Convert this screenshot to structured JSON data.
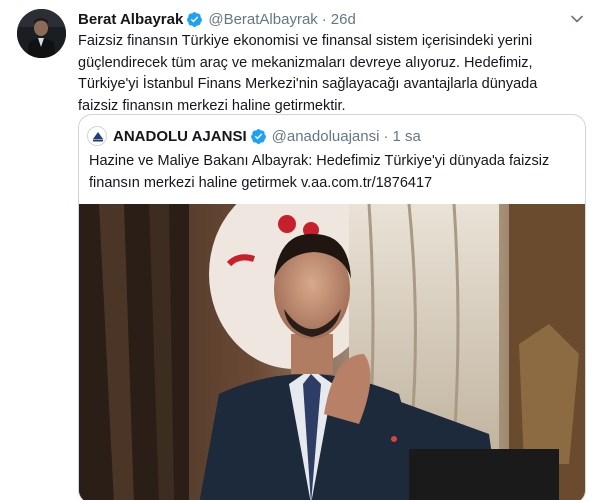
{
  "tweet": {
    "author_name": "Berat Albayrak",
    "handle": "@BeratAlbayrak",
    "separator": "·",
    "time": "26d",
    "text_lines": [
      "Faizsiz finansın Türkiye ekonomisi ve finansal sistem içerisindeki yerini",
      "güçlendirecek tüm araç ve mekanizmaları devreye alıyoruz. Hedefimiz,",
      "Türkiye'yi İstanbul Finans Merkezi'nin sağlayacağı avantajlarla dünyada",
      "faizsiz finansın merkezi haline getirmektir."
    ]
  },
  "quoted_tweet": {
    "author_name": "ANADOLU AJANSI",
    "handle": "@anadoluajansi",
    "separator": "·",
    "time": "1 sa",
    "text_lines": [
      "Hazine ve Maliye Bakanı Albayrak: Hedefimiz Türkiye'yi dünyada faizsiz",
      "finansın merkezi haline getirmek v.aa.com.tr/1876417"
    ]
  },
  "icons": {
    "verified": "verified-badge-icon",
    "caret": "chevron-down-icon"
  },
  "colors": {
    "accent": "#1da1f2",
    "secondary_text": "#657786",
    "border": "#ccd6dd"
  }
}
